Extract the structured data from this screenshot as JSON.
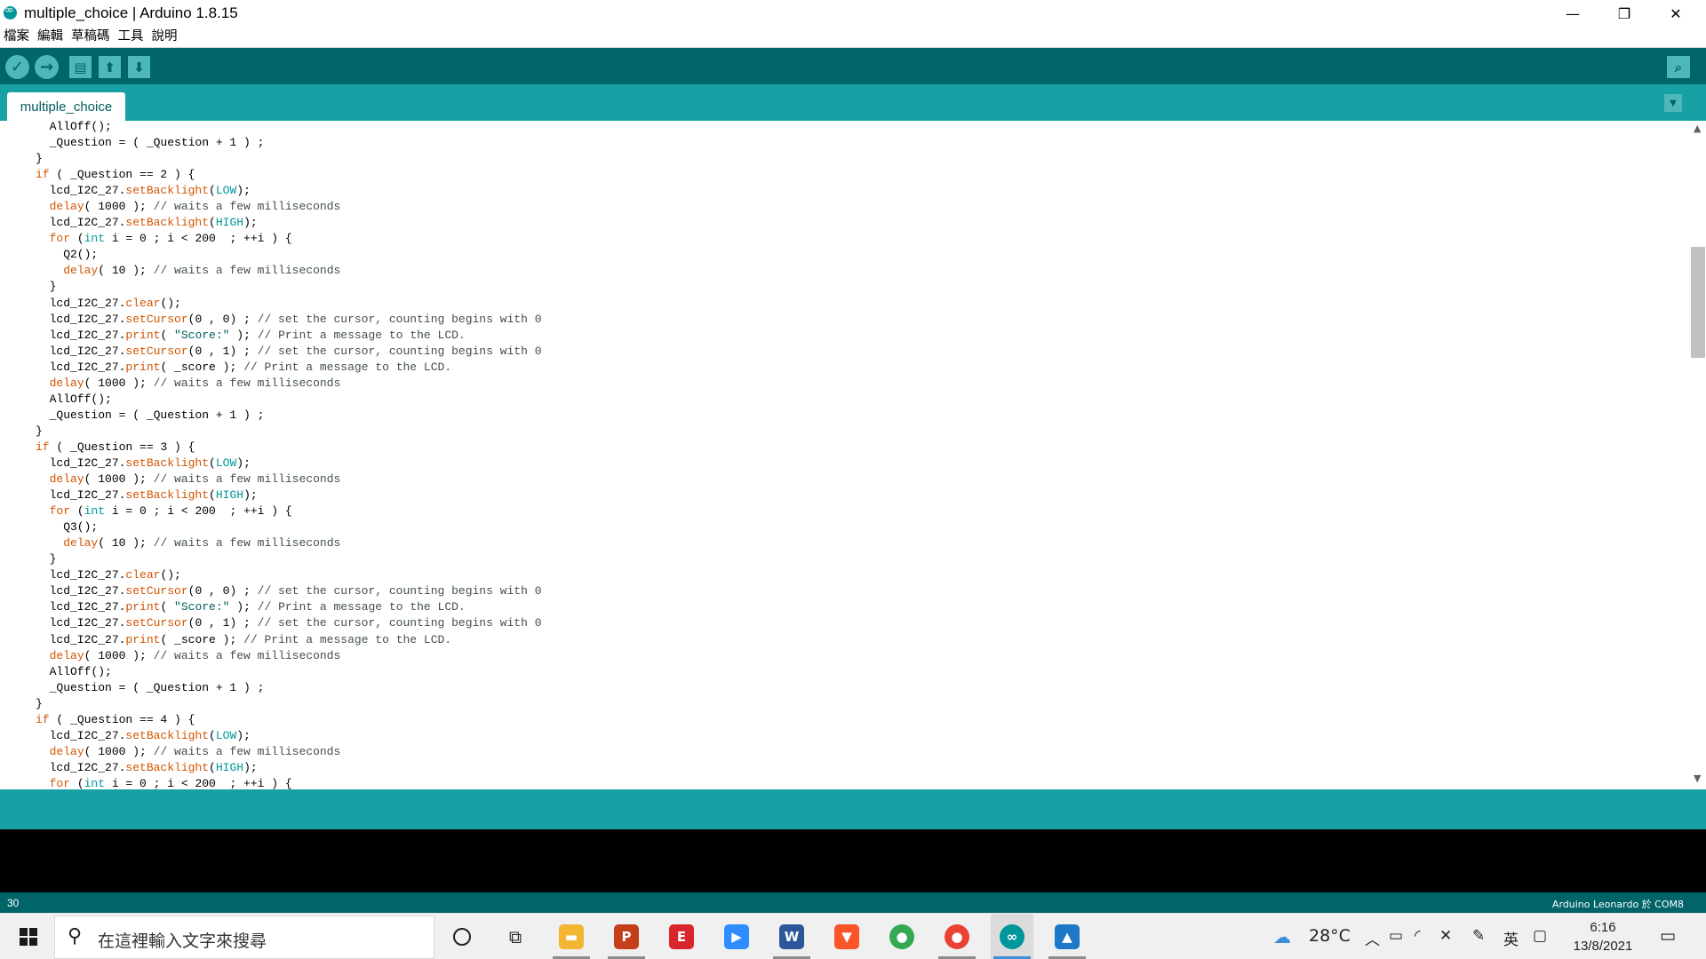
{
  "window": {
    "title": "multiple_choice | Arduino 1.8.15",
    "minimize": "—",
    "maximize": "❐",
    "close": "✕"
  },
  "menu": [
    "檔案",
    "編輯",
    "草稿碼",
    "工具",
    "說明"
  ],
  "toolbar": {
    "verify_icon": "checkmark-icon",
    "upload_icon": "arrow-right-icon",
    "new_icon": "new-file-icon",
    "open_icon": "open-arrow-up-icon",
    "save_icon": "save-arrow-down-icon",
    "monitor_icon": "serial-monitor-icon"
  },
  "tabs": [
    {
      "label": "multiple_choice",
      "active": true
    }
  ],
  "editor": {
    "code_lines": [
      "  AllOff();",
      "  _Question = ( _Question + 1 ) ;",
      "}",
      "if ( _Question == 2 ) {",
      "  lcd_I2C_27.setBacklight(LOW);",
      "  delay( 1000 ); // waits a few milliseconds",
      "  lcd_I2C_27.setBacklight(HIGH);",
      "  for (int i = 0 ; i < 200  ; ++i ) {",
      "    Q2();",
      "    delay( 10 ); // waits a few milliseconds",
      "  }",
      "  lcd_I2C_27.clear();",
      "  lcd_I2C_27.setCursor(0 , 0) ; // set the cursor, counting begins with 0",
      "  lcd_I2C_27.print( \"Score:\" ); // Print a message to the LCD.",
      "  lcd_I2C_27.setCursor(0 , 1) ; // set the cursor, counting begins with 0",
      "  lcd_I2C_27.print( _score ); // Print a message to the LCD.",
      "  delay( 1000 ); // waits a few milliseconds",
      "  AllOff();",
      "  _Question = ( _Question + 1 ) ;",
      "}",
      "if ( _Question == 3 ) {",
      "  lcd_I2C_27.setBacklight(LOW);",
      "  delay( 1000 ); // waits a few milliseconds",
      "  lcd_I2C_27.setBacklight(HIGH);",
      "  for (int i = 0 ; i < 200  ; ++i ) {",
      "    Q3();",
      "    delay( 10 ); // waits a few milliseconds",
      "  }",
      "  lcd_I2C_27.clear();",
      "  lcd_I2C_27.setCursor(0 , 0) ; // set the cursor, counting begins with 0",
      "  lcd_I2C_27.print( \"Score:\" ); // Print a message to the LCD.",
      "  lcd_I2C_27.setCursor(0 , 1) ; // set the cursor, counting begins with 0",
      "  lcd_I2C_27.print( _score ); // Print a message to the LCD.",
      "  delay( 1000 ); // waits a few milliseconds",
      "  AllOff();",
      "  _Question = ( _Question + 1 ) ;",
      "}",
      "if ( _Question == 4 ) {",
      "  lcd_I2C_27.setBacklight(LOW);",
      "  delay( 1000 ); // waits a few milliseconds",
      "  lcd_I2C_27.setBacklight(HIGH);",
      "  for (int i = 0 ; i < 200  ; ++i ) {"
    ]
  },
  "footer": {
    "line_number": "30",
    "board_info": "Arduino Leonardo 於 COM8"
  },
  "taskbar": {
    "search_placeholder": "在這裡輸入文字來搜尋",
    "apps": [
      {
        "name": "file-explorer",
        "color": "#f2b632",
        "glyph": "▬",
        "running": true,
        "active": false
      },
      {
        "name": "powerpoint",
        "color": "#c43e1c",
        "glyph": "P",
        "running": true,
        "active": false
      },
      {
        "name": "eph-app",
        "color": "#d9262c",
        "glyph": "E",
        "running": false,
        "active": false
      },
      {
        "name": "zoom",
        "color": "#2d8cff",
        "glyph": "▶",
        "running": false,
        "active": false
      },
      {
        "name": "word",
        "color": "#2b579a",
        "glyph": "W",
        "running": true,
        "active": false
      },
      {
        "name": "brave",
        "color": "#fb542b",
        "glyph": "▼",
        "running": false,
        "active": false
      },
      {
        "name": "chrome",
        "color": "#34a853",
        "glyph": "●",
        "running": false,
        "active": false
      },
      {
        "name": "chrome-profile",
        "color": "#ea4335",
        "glyph": "●",
        "running": true,
        "active": false
      },
      {
        "name": "arduino",
        "color": "#00979c",
        "glyph": "∞",
        "running": true,
        "active": true
      },
      {
        "name": "photos",
        "color": "#1e78c8",
        "glyph": "▲",
        "running": true,
        "active": false
      }
    ],
    "temperature": "28°C",
    "ime": "英",
    "time": "6:16",
    "date": "13/8/2021"
  }
}
